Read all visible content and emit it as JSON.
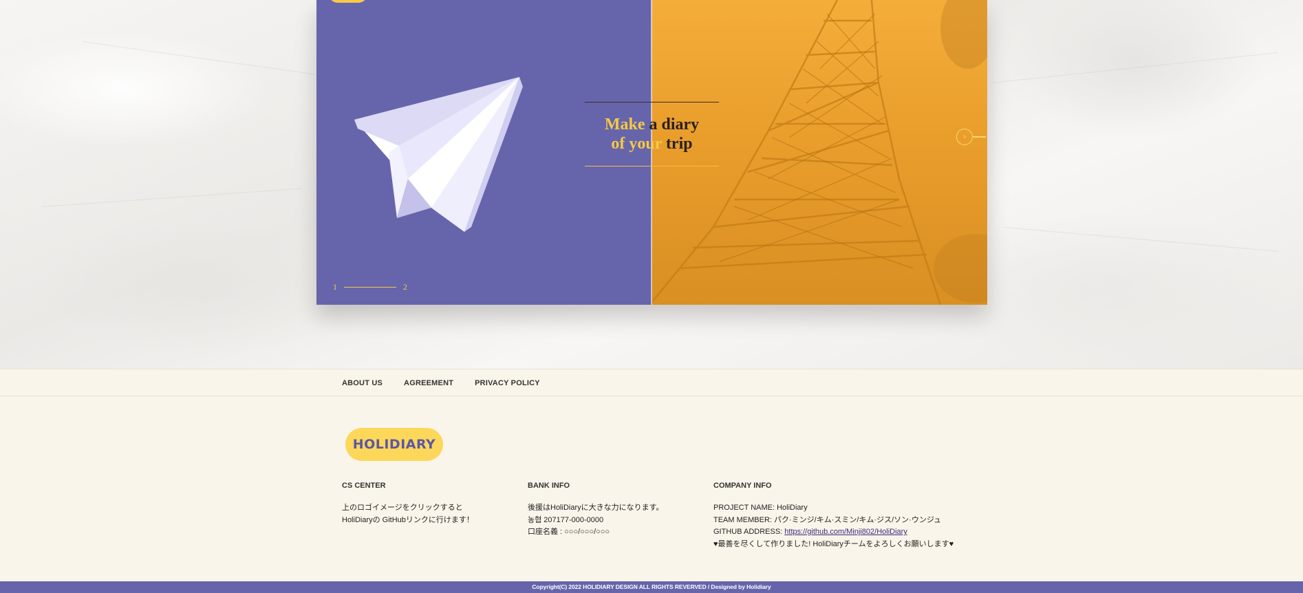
{
  "slider": {
    "tagline_line1_accent": "Make",
    "tagline_line1_rest": " a diary",
    "tagline_line2_accent": "of your",
    "tagline_line2_rest": " trip",
    "pager_current": "1",
    "pager_total": "2",
    "left_bg_color": "#6665ab",
    "right_bg_color": "#f5ad3a",
    "accent_color": "#f5c945",
    "next_icon": "chevron-right-icon"
  },
  "footer": {
    "nav": [
      "ABOUT US",
      "AGREEMENT",
      "PRIVACY POLICY"
    ],
    "logo_text": "HOLIDIARY",
    "cs_center": {
      "title": "CS CENTER",
      "lines": [
        "上のロゴイメージをクリックすると",
        "HoliDiaryの GitHubリンクに行けます！"
      ]
    },
    "bank_info": {
      "title": "BANK INFO",
      "lines": [
        "後援はHoliDiaryに大きな力になります。",
        "농협 207177-000-0000",
        "口座名義 : ○○○/○○○/○○○"
      ]
    },
    "company_info": {
      "title": "COMPANY INFO",
      "project": "PROJECT NAME: HoliDiary",
      "team": "TEAM MEMBER: パク·ミンジ/キム·スミン/キム·ジス/ソン·ウンジュ",
      "github_label": "GITHUB ADDRESS: ",
      "github_url": "https://github.com/Minji802/HoliDiary",
      "closing": "♥最善を尽くして作りました! HoliDiaryチームをよろしくお願いします♥"
    },
    "copyright": "Copyright(C) 2022 HOLIDIARY DESIGN ALL RIGHTS REVERVED / Designed by Holidiary"
  }
}
